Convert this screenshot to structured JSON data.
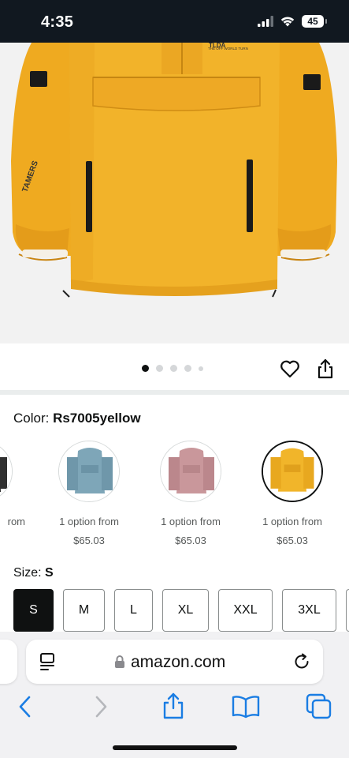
{
  "status_bar": {
    "time": "4:35",
    "battery": "45"
  },
  "product": {
    "image_alt": "Yellow hooded anorak jacket",
    "jacket_print_lines": [
      "TAMERS",
      "THE OFF WORLD TURN"
    ]
  },
  "gallery": {
    "active_dot_index": 0,
    "total_dots": 5
  },
  "color": {
    "label": "Color: ",
    "selected_value": "Rs7005yellow"
  },
  "swatches": [
    {
      "name": "black",
      "color": "#2a2a2a",
      "line1": "rom",
      "price": "$",
      "selected": false
    },
    {
      "name": "blue",
      "color": "#7ea6b8",
      "line1": "1 option from",
      "price": "$65.03",
      "selected": false
    },
    {
      "name": "pink",
      "color": "#c9979b",
      "line1": "1 option from",
      "price": "$65.03",
      "selected": false
    },
    {
      "name": "yellow",
      "color": "#f1b52a",
      "line1": "1 option from",
      "price": "$65.03",
      "selected": true
    }
  ],
  "size": {
    "label": "Size: ",
    "selected_value": "S",
    "options": [
      "S",
      "M",
      "L",
      "XL",
      "XXL",
      "3XL"
    ]
  },
  "browser": {
    "url": "amazon.com"
  },
  "icons": {
    "wishlist": "heart-icon",
    "share": "share-icon",
    "tabs_menu": "reader-icon",
    "lock": "lock-icon",
    "reload": "reload-icon",
    "back": "back-icon",
    "forward": "forward-icon",
    "share_sheet": "share-icon",
    "bookmarks": "bookmarks-icon",
    "tabs": "tabs-icon"
  },
  "colors": {
    "accent_blue": "#1a7de3",
    "jacket_yellow": "#f2b32a",
    "selected_black": "#0f1111"
  }
}
